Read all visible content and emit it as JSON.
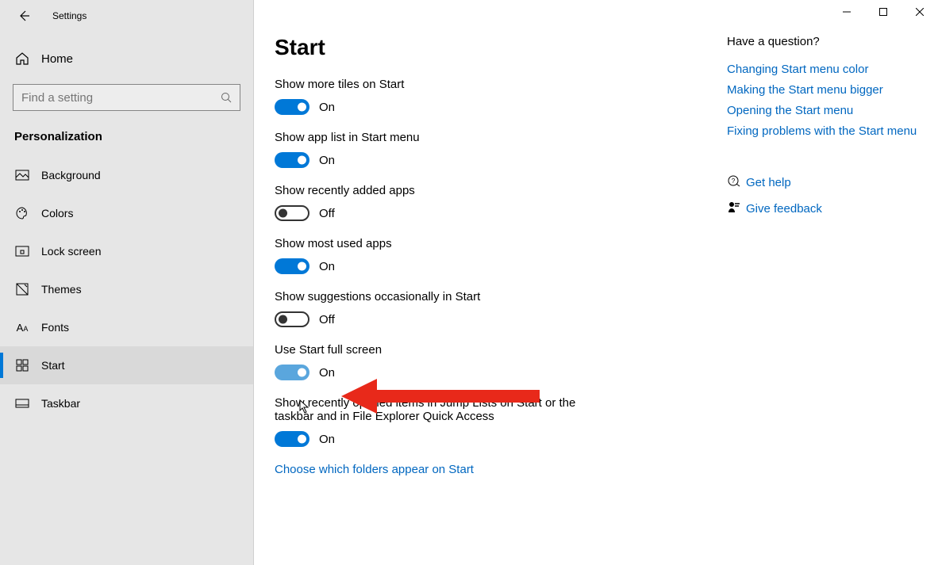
{
  "window": {
    "title": "Settings"
  },
  "sidebar": {
    "home": "Home",
    "search_placeholder": "Find a setting",
    "category": "Personalization",
    "items": [
      {
        "label": "Background"
      },
      {
        "label": "Colors"
      },
      {
        "label": "Lock screen"
      },
      {
        "label": "Themes"
      },
      {
        "label": "Fonts"
      },
      {
        "label": "Start"
      },
      {
        "label": "Taskbar"
      }
    ]
  },
  "page": {
    "heading": "Start",
    "settings": [
      {
        "label": "Show more tiles on Start",
        "state": "On",
        "on": true
      },
      {
        "label": "Show app list in Start menu",
        "state": "On",
        "on": true
      },
      {
        "label": "Show recently added apps",
        "state": "Off",
        "on": false
      },
      {
        "label": "Show most used apps",
        "state": "On",
        "on": true
      },
      {
        "label": "Show suggestions occasionally in Start",
        "state": "Off",
        "on": false
      },
      {
        "label": "Use Start full screen",
        "state": "On",
        "on": true,
        "semi": true
      },
      {
        "label": "Show recently opened items in Jump Lists on Start or the taskbar and in File Explorer Quick Access",
        "state": "On",
        "on": true
      }
    ],
    "footer_link": "Choose which folders appear on Start"
  },
  "aside": {
    "question": "Have a question?",
    "links": [
      "Changing Start menu color",
      "Making the Start menu bigger",
      "Opening the Start menu",
      "Fixing problems with the Start menu"
    ],
    "help": "Get help",
    "feedback": "Give feedback"
  }
}
